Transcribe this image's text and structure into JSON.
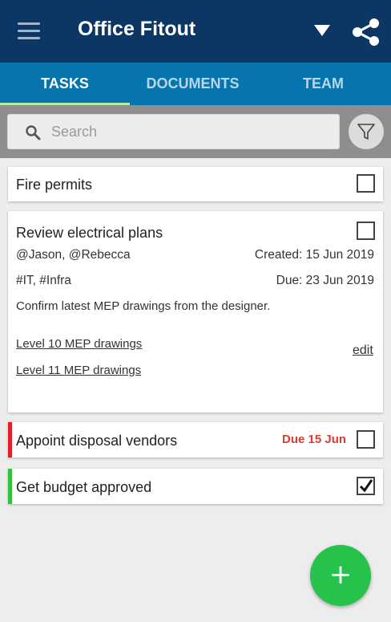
{
  "app": {
    "title": "Office Fitout"
  },
  "tabs": [
    {
      "label": "TASKS",
      "active": true
    },
    {
      "label": "DOCUMENTS",
      "active": false
    },
    {
      "label": "TEAM",
      "active": false
    }
  ],
  "search": {
    "placeholder": "Search",
    "value": ""
  },
  "tasks": [
    {
      "title": "Fire permits",
      "done": false
    },
    {
      "title": "Review electrical plans",
      "done": false,
      "assignees": "@Jason, @Rebecca",
      "created": "Created: 15 Jun 2019",
      "tags": "#IT, #Infra",
      "due": "Due: 23 Jun 2019",
      "description": "Confirm latest MEP drawings from the designer.",
      "links": [
        "Level 10 MEP drawings",
        "Level 11 MEP drawings"
      ],
      "edit_label": "edit"
    },
    {
      "title": "Appoint disposal vendors",
      "done": false,
      "due_badge": "Due 15 Jun",
      "stripe_color": "#e0202a"
    },
    {
      "title": "Get budget approved",
      "done": true,
      "stripe_color": "#33c03a"
    }
  ],
  "icons": {
    "menu": "hamburger-icon",
    "dropdown": "caret-down-icon",
    "share": "share-icon",
    "search": "search-icon",
    "filter": "filter-icon",
    "add": "plus-icon"
  },
  "fab": {
    "label": "+"
  },
  "colors": {
    "appbar": "#0c3764",
    "tabbar": "#0675ad",
    "accent_green": "#27c24c",
    "overdue_red": "#e03a2f"
  }
}
